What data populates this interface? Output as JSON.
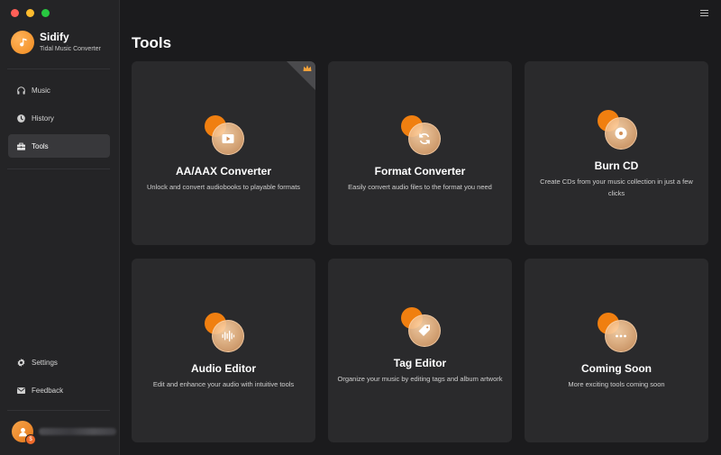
{
  "app": {
    "name": "Sidify",
    "subtitle": "Tidal Music Converter"
  },
  "sidebar": {
    "items": [
      {
        "label": "Music",
        "icon": "headphones-icon"
      },
      {
        "label": "History",
        "icon": "clock-icon"
      },
      {
        "label": "Tools",
        "icon": "toolbox-icon",
        "active": true
      }
    ],
    "bottom_items": [
      {
        "label": "Settings",
        "icon": "gear-icon"
      },
      {
        "label": "Feedback",
        "icon": "mail-icon"
      }
    ]
  },
  "page": {
    "title": "Tools"
  },
  "tools": [
    {
      "title": "AA/AAX Converter",
      "description": "Unlock and convert audiobooks to playable formats",
      "icon": "play-video-icon",
      "premium": true
    },
    {
      "title": "Format Converter",
      "description": "Easily convert audio files to the format you need",
      "icon": "refresh-icon"
    },
    {
      "title": "Burn CD",
      "description": "Create CDs from your music collection in just a few clicks",
      "icon": "disc-icon"
    },
    {
      "title": "Audio Editor",
      "description": "Edit and enhance your audio with intuitive tools",
      "icon": "waveform-icon"
    },
    {
      "title": "Tag Editor",
      "description": "Organize your music by editing tags and album artwork",
      "icon": "tag-icon"
    },
    {
      "title": "Coming Soon",
      "description": "More exciting tools coming soon",
      "icon": "more-icon"
    }
  ],
  "colors": {
    "accent": "#f07f10",
    "background": "#1b1b1d",
    "card": "#2a2a2c",
    "sidebar": "#242426"
  }
}
